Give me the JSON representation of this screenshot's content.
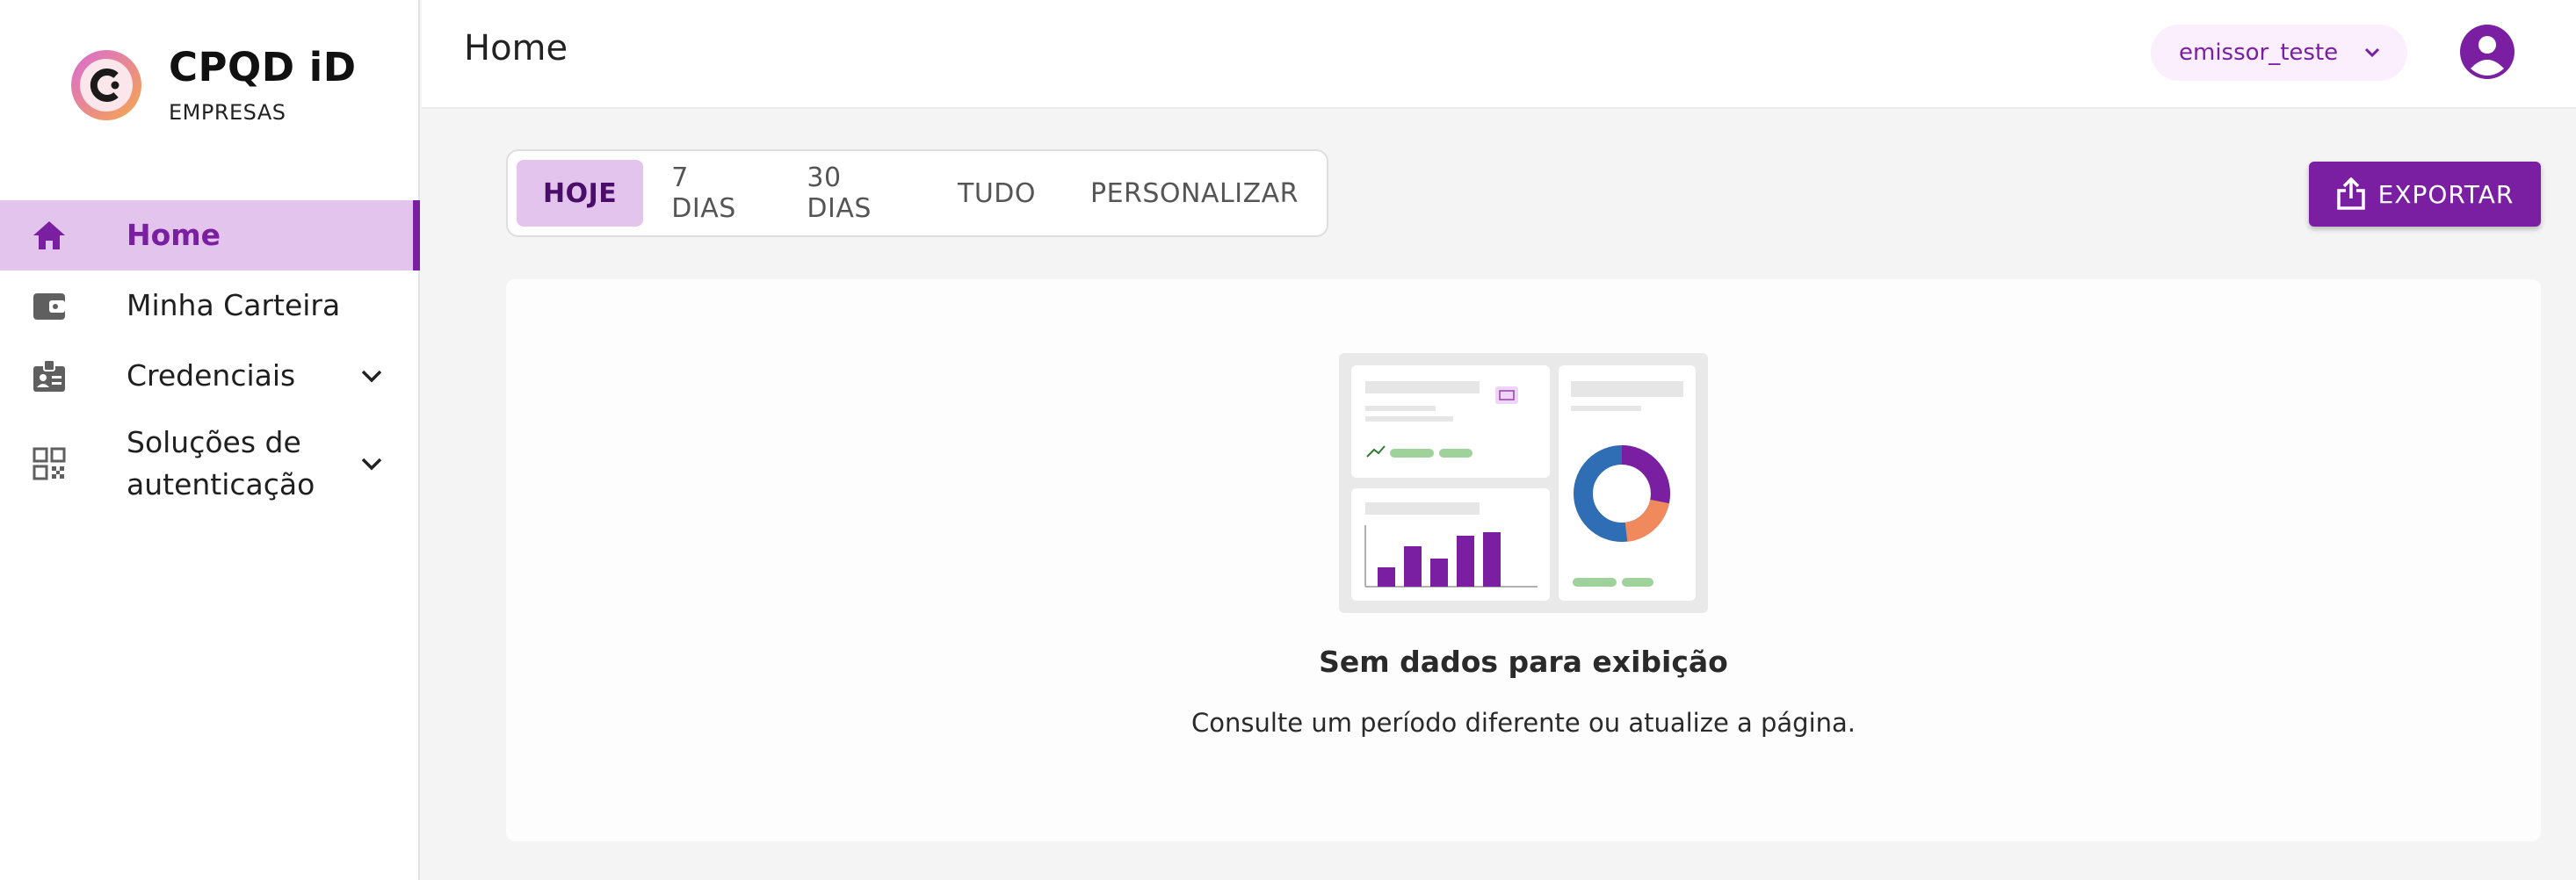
{
  "brand": {
    "name": "CPQD iD",
    "subtitle": "EMPRESAS"
  },
  "sidebar": {
    "items": [
      {
        "label": "Home",
        "icon": "home-icon",
        "active": true
      },
      {
        "label": "Minha Carteira",
        "icon": "wallet-icon"
      },
      {
        "label": "Credenciais",
        "icon": "badge-icon",
        "expandable": true
      },
      {
        "label": "Soluções de autenticação",
        "icon": "qr-code-icon",
        "expandable": true
      }
    ]
  },
  "header": {
    "title": "Home",
    "user": "emissor_teste"
  },
  "filters": {
    "options": [
      "HOJE",
      "7 DIAS",
      "30 DIAS",
      "TUDO",
      "PERSONALIZAR"
    ],
    "selected": "HOJE"
  },
  "actions": {
    "export_label": "EXPORTAR"
  },
  "empty_state": {
    "title": "Sem dados para exibição",
    "subtitle": "Consulte um período diferente ou atualize a página."
  },
  "colors": {
    "accent": "#7b1fa2",
    "accent_light": "#e3c4ec",
    "background": "#f4f4f4"
  }
}
